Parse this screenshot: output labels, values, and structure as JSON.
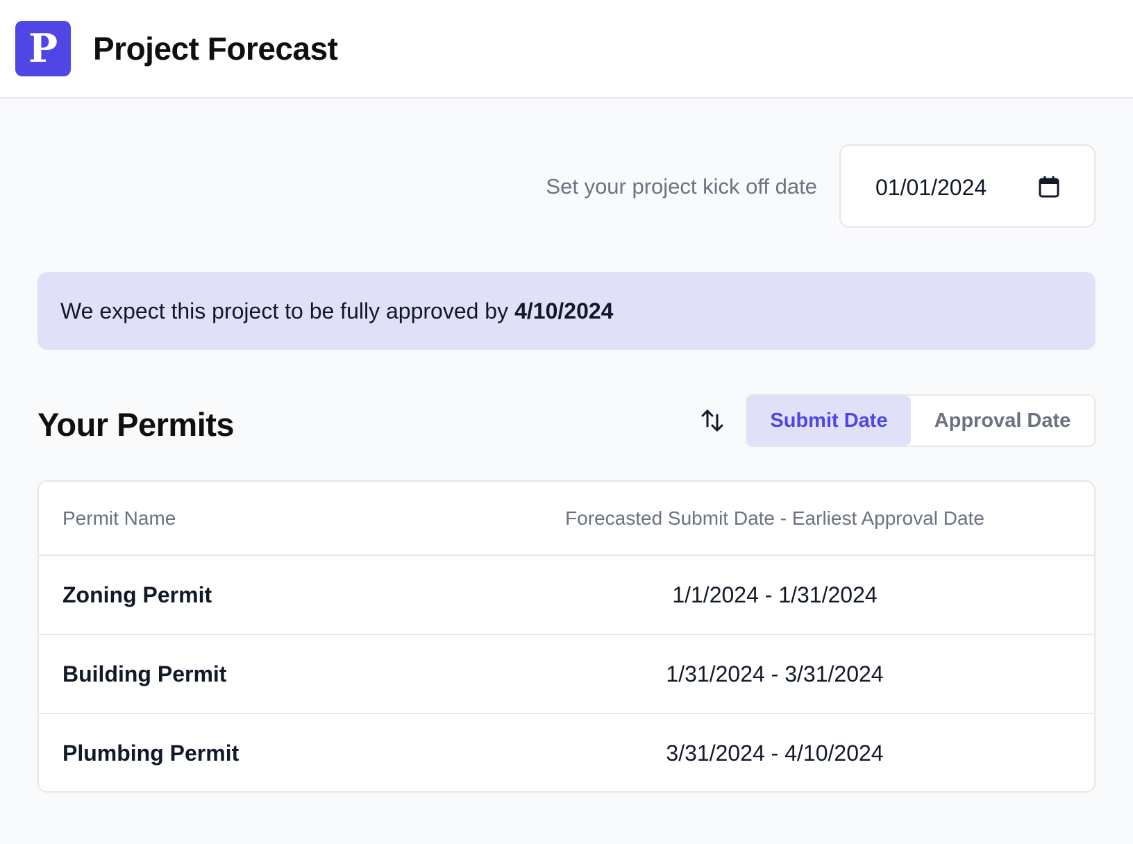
{
  "header": {
    "logo_letter": "P",
    "title": "Project Forecast"
  },
  "kickoff": {
    "label": "Set your project kick off date",
    "date_value": "01/01/2024",
    "icon": "calendar-icon"
  },
  "banner": {
    "text": "We expect this project to be fully approved by",
    "approval_date": "4/10/2024"
  },
  "permits": {
    "title": "Your Permits",
    "sort_icon": "sort-arrows-icon",
    "sort_options": [
      {
        "label": "Submit Date",
        "active": true
      },
      {
        "label": "Approval Date",
        "active": false
      }
    ],
    "columns": [
      "Permit Name",
      "Forecasted Submit Date - Earliest Approval Date"
    ],
    "rows": [
      {
        "name": "Zoning Permit",
        "dates": "1/1/2024 - 1/31/2024"
      },
      {
        "name": "Building Permit",
        "dates": "1/31/2024 - 3/31/2024"
      },
      {
        "name": "Plumbing Permit",
        "dates": "3/31/2024 - 4/10/2024"
      }
    ]
  },
  "colors": {
    "accent": "#4f46e5",
    "banner_bg": "#e0e1f9",
    "page_bg": "#f8fafc",
    "muted_text": "#6b7280",
    "border": "#e5e7eb"
  }
}
